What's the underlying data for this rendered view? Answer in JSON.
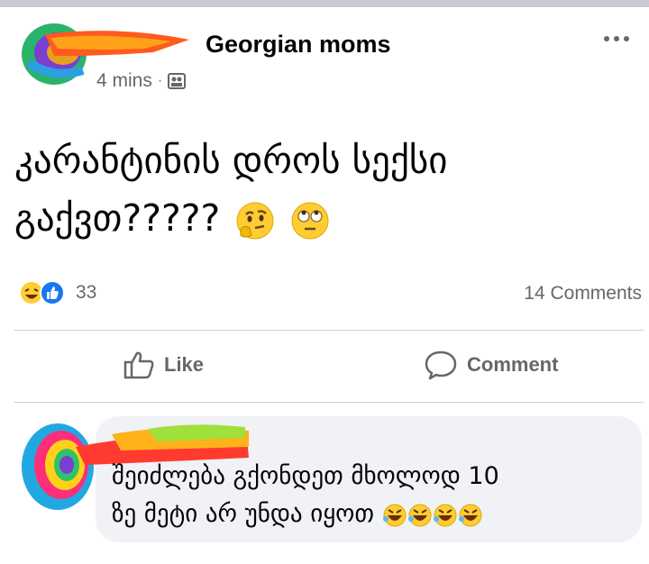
{
  "post": {
    "group_name": "Georgian moms",
    "timestamp": "4 mins",
    "separator": "·",
    "privacy_icon": "group-icon",
    "text_line1": "კარანტინის დროს სექსი",
    "text_line2": "გაქვთ?????",
    "emojis": [
      "thinking-face",
      "face-with-rolling-eyes"
    ]
  },
  "reactions": {
    "icons": [
      "laughing-face",
      "like-thumbs"
    ],
    "count": "33",
    "comments": "14 Comments"
  },
  "actions": {
    "like_label": "Like",
    "comment_label": "Comment"
  },
  "comment": {
    "text_line1": "შეიძლება გქონდეთ მხოლოდ 10",
    "text_line2": "ზე მეტი არ უნდა იყოთ",
    "emojis": [
      "rolling-laughing-face",
      "rolling-laughing-face",
      "rolling-laughing-face",
      "rolling-laughing-face"
    ]
  },
  "colors": {
    "text": "#050505",
    "secondary": "#65676b",
    "bubble": "#f0f2f5",
    "divider": "#ced0d4",
    "like_blue": "#1877f2"
  }
}
